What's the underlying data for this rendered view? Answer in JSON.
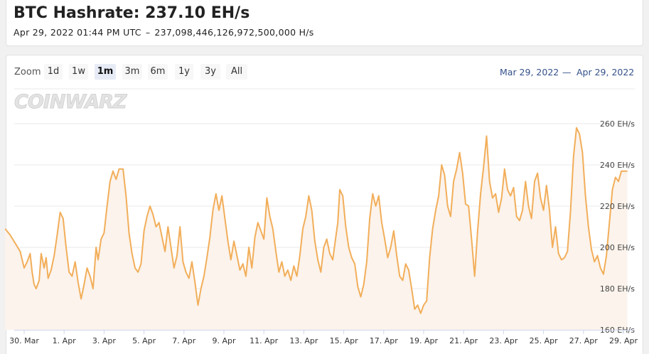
{
  "header": {
    "title": "BTC Hashrate: 237.10 EH/s",
    "timestamp": "Apr 29, 2022 01:44 PM UTC",
    "separator": "–",
    "hashrate_full": "237,098,446,126,972,500,000 H/s"
  },
  "zoom": {
    "label": "Zoom",
    "buttons": [
      "1d",
      "1w",
      "1m",
      "3m",
      "6m",
      "1y",
      "3y",
      "All"
    ],
    "active": "1m"
  },
  "range": {
    "from": "Mar 29, 2022",
    "dash": "—",
    "to": "Apr 29, 2022"
  },
  "logo": {
    "text": "COINWARZ"
  },
  "colors": {
    "line": "#f2ae5a",
    "fill": "#fbf3ec"
  },
  "chart_data": {
    "type": "area",
    "title": "",
    "xlabel": "",
    "ylabel": "",
    "ylim": [
      160,
      260
    ],
    "y_ticks": [
      {
        "value": 160,
        "label": "160 EH/s"
      },
      {
        "value": 180,
        "label": "180 EH/s"
      },
      {
        "value": 200,
        "label": "200 EH/s"
      },
      {
        "value": 220,
        "label": "220 EH/s"
      },
      {
        "value": 240,
        "label": "240 EH/s"
      },
      {
        "value": 260,
        "label": "260 EH/s"
      }
    ],
    "x_ticks": [
      {
        "day": 1,
        "label": "30. Mar"
      },
      {
        "day": 3,
        "label": "1. Apr"
      },
      {
        "day": 5,
        "label": "3. Apr"
      },
      {
        "day": 7,
        "label": "5. Apr"
      },
      {
        "day": 9,
        "label": "7. Apr"
      },
      {
        "day": 11,
        "label": "9. Apr"
      },
      {
        "day": 13,
        "label": "11. Apr"
      },
      {
        "day": 15,
        "label": "13. Apr"
      },
      {
        "day": 17,
        "label": "15. Apr"
      },
      {
        "day": 19,
        "label": "17. Apr"
      },
      {
        "day": 21,
        "label": "19. Apr"
      },
      {
        "day": 23,
        "label": "21. Apr"
      },
      {
        "day": 25,
        "label": "23. Apr"
      },
      {
        "day": 27,
        "label": "25. Apr"
      },
      {
        "day": 29,
        "label": "27. Apr"
      },
      {
        "day": 31,
        "label": "29. Apr"
      }
    ],
    "x_range": [
      0.05,
      31.2
    ],
    "series": [
      {
        "name": "",
        "points": [
          [
            0.05,
            209
          ],
          [
            0.3,
            206
          ],
          [
            0.55,
            202
          ],
          [
            0.8,
            198
          ],
          [
            1.0,
            190
          ],
          [
            1.15,
            193
          ],
          [
            1.3,
            197
          ],
          [
            1.4,
            188
          ],
          [
            1.5,
            182
          ],
          [
            1.6,
            180
          ],
          [
            1.75,
            184
          ],
          [
            1.85,
            197
          ],
          [
            2.0,
            190
          ],
          [
            2.1,
            195
          ],
          [
            2.2,
            185
          ],
          [
            2.35,
            189
          ],
          [
            2.5,
            196
          ],
          [
            2.65,
            206
          ],
          [
            2.8,
            217
          ],
          [
            2.95,
            214
          ],
          [
            3.1,
            200
          ],
          [
            3.25,
            188
          ],
          [
            3.4,
            186
          ],
          [
            3.55,
            193
          ],
          [
            3.7,
            183
          ],
          [
            3.85,
            175
          ],
          [
            4.0,
            182
          ],
          [
            4.15,
            190
          ],
          [
            4.3,
            186
          ],
          [
            4.45,
            180
          ],
          [
            4.6,
            200
          ],
          [
            4.7,
            194
          ],
          [
            4.85,
            204
          ],
          [
            5.0,
            207
          ],
          [
            5.15,
            220
          ],
          [
            5.3,
            232
          ],
          [
            5.45,
            237
          ],
          [
            5.6,
            233
          ],
          [
            5.75,
            238
          ],
          [
            5.95,
            238
          ],
          [
            6.1,
            225
          ],
          [
            6.25,
            207
          ],
          [
            6.4,
            197
          ],
          [
            6.55,
            190
          ],
          [
            6.7,
            188
          ],
          [
            6.85,
            192
          ],
          [
            7.0,
            208
          ],
          [
            7.15,
            215
          ],
          [
            7.3,
            220
          ],
          [
            7.45,
            216
          ],
          [
            7.6,
            210
          ],
          [
            7.75,
            212
          ],
          [
            7.9,
            205
          ],
          [
            8.05,
            198
          ],
          [
            8.2,
            210
          ],
          [
            8.35,
            200
          ],
          [
            8.5,
            190
          ],
          [
            8.65,
            196
          ],
          [
            8.8,
            210
          ],
          [
            8.95,
            193
          ],
          [
            9.1,
            188
          ],
          [
            9.25,
            185
          ],
          [
            9.4,
            193
          ],
          [
            9.55,
            183
          ],
          [
            9.7,
            172
          ],
          [
            9.85,
            180
          ],
          [
            10.0,
            186
          ],
          [
            10.15,
            195
          ],
          [
            10.3,
            205
          ],
          [
            10.45,
            218
          ],
          [
            10.6,
            226
          ],
          [
            10.75,
            218
          ],
          [
            10.9,
            225
          ],
          [
            11.05,
            214
          ],
          [
            11.2,
            203
          ],
          [
            11.35,
            194
          ],
          [
            11.5,
            203
          ],
          [
            11.65,
            196
          ],
          [
            11.8,
            189
          ],
          [
            11.95,
            192
          ],
          [
            12.1,
            186
          ],
          [
            12.25,
            200
          ],
          [
            12.4,
            190
          ],
          [
            12.55,
            205
          ],
          [
            12.7,
            212
          ],
          [
            12.85,
            208
          ],
          [
            13.0,
            204
          ],
          [
            13.15,
            224
          ],
          [
            13.3,
            215
          ],
          [
            13.45,
            209
          ],
          [
            13.6,
            198
          ],
          [
            13.75,
            188
          ],
          [
            13.9,
            193
          ],
          [
            14.05,
            186
          ],
          [
            14.2,
            189
          ],
          [
            14.35,
            184
          ],
          [
            14.5,
            191
          ],
          [
            14.65,
            186
          ],
          [
            14.8,
            196
          ],
          [
            14.95,
            209
          ],
          [
            15.1,
            215
          ],
          [
            15.25,
            225
          ],
          [
            15.4,
            218
          ],
          [
            15.55,
            203
          ],
          [
            15.7,
            194
          ],
          [
            15.85,
            188
          ],
          [
            16.0,
            200
          ],
          [
            16.15,
            204
          ],
          [
            16.3,
            197
          ],
          [
            16.45,
            194
          ],
          [
            16.6,
            205
          ],
          [
            16.7,
            212
          ],
          [
            16.8,
            228
          ],
          [
            16.95,
            225
          ],
          [
            17.1,
            210
          ],
          [
            17.25,
            200
          ],
          [
            17.4,
            195
          ],
          [
            17.55,
            192
          ],
          [
            17.7,
            181
          ],
          [
            17.85,
            176
          ],
          [
            18.0,
            182
          ],
          [
            18.15,
            193
          ],
          [
            18.3,
            214
          ],
          [
            18.45,
            226
          ],
          [
            18.6,
            220
          ],
          [
            18.75,
            225
          ],
          [
            18.9,
            212
          ],
          [
            19.05,
            204
          ],
          [
            19.2,
            195
          ],
          [
            19.35,
            200
          ],
          [
            19.5,
            208
          ],
          [
            19.65,
            196
          ],
          [
            19.8,
            186
          ],
          [
            19.95,
            184
          ],
          [
            20.1,
            192
          ],
          [
            20.25,
            189
          ],
          [
            20.4,
            180
          ],
          [
            20.55,
            170
          ],
          [
            20.7,
            172
          ],
          [
            20.85,
            168
          ],
          [
            21.0,
            172
          ],
          [
            21.15,
            174
          ],
          [
            21.3,
            195
          ],
          [
            21.45,
            209
          ],
          [
            21.6,
            218
          ],
          [
            21.75,
            225
          ],
          [
            21.9,
            240
          ],
          [
            22.05,
            235
          ],
          [
            22.2,
            220
          ],
          [
            22.35,
            215
          ],
          [
            22.5,
            232
          ],
          [
            22.65,
            238
          ],
          [
            22.8,
            246
          ],
          [
            22.95,
            236
          ],
          [
            23.1,
            221
          ],
          [
            23.25,
            220
          ],
          [
            23.4,
            204
          ],
          [
            23.55,
            186
          ],
          [
            23.7,
            208
          ],
          [
            23.85,
            226
          ],
          [
            24.0,
            239
          ],
          [
            24.15,
            254
          ],
          [
            24.3,
            232
          ],
          [
            24.45,
            224
          ],
          [
            24.6,
            226
          ],
          [
            24.75,
            217
          ],
          [
            24.9,
            224
          ],
          [
            25.05,
            238
          ],
          [
            25.2,
            228
          ],
          [
            25.35,
            225
          ],
          [
            25.5,
            229
          ],
          [
            25.65,
            215
          ],
          [
            25.8,
            213
          ],
          [
            25.95,
            218
          ],
          [
            26.1,
            232
          ],
          [
            26.25,
            220
          ],
          [
            26.4,
            214
          ],
          [
            26.55,
            232
          ],
          [
            26.7,
            236
          ],
          [
            26.85,
            224
          ],
          [
            27.0,
            218
          ],
          [
            27.15,
            230
          ],
          [
            27.3,
            218
          ],
          [
            27.45,
            200
          ],
          [
            27.6,
            210
          ],
          [
            27.75,
            197
          ],
          [
            27.9,
            194
          ],
          [
            28.05,
            195
          ],
          [
            28.2,
            198
          ],
          [
            28.35,
            217
          ],
          [
            28.5,
            244
          ],
          [
            28.65,
            258
          ],
          [
            28.8,
            255
          ],
          [
            28.95,
            246
          ],
          [
            29.1,
            225
          ],
          [
            29.25,
            210
          ],
          [
            29.4,
            199
          ],
          [
            29.55,
            193
          ],
          [
            29.7,
            196
          ],
          [
            29.85,
            190
          ],
          [
            30.0,
            187
          ],
          [
            30.15,
            196
          ],
          [
            30.3,
            212
          ],
          [
            30.45,
            228
          ],
          [
            30.6,
            234
          ],
          [
            30.75,
            232
          ],
          [
            30.9,
            237
          ],
          [
            31.05,
            237
          ],
          [
            31.2,
            237
          ]
        ]
      }
    ]
  }
}
